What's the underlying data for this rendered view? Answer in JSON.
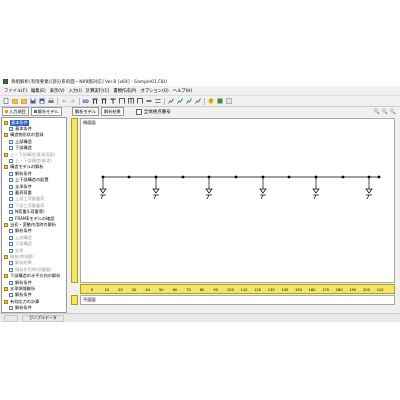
{
  "window": {
    "title": "骨組解析(有限要素)[部分系斜面・N09版対応] Ver.8 [x64] - Sample01.F8U"
  },
  "menu": [
    "ファイル(F)",
    "編集(E)",
    "表示(V)",
    "入力(I)",
    "計算実行(C)",
    "書類作成(P)",
    "オプション(O)",
    "ヘルプ(H)"
  ],
  "left_tabs": [
    "入力項目",
    "解析モデル"
  ],
  "tree": [
    {
      "label": "基本条件",
      "type": "folder",
      "level": 0,
      "state": "selected"
    },
    {
      "label": "基本条件",
      "type": "doc",
      "level": 1,
      "state": "normal"
    },
    {
      "label": "構造物形状の登録",
      "type": "folder",
      "level": 0,
      "state": "normal"
    },
    {
      "label": "上部構造",
      "type": "doc",
      "level": 1,
      "state": "normal"
    },
    {
      "label": "下部構造",
      "type": "doc",
      "level": 1,
      "state": "normal"
    },
    {
      "label": "上・下部構造(基本画面)",
      "type": "folder",
      "level": 0,
      "state": "dim"
    },
    {
      "label": "上・下部構造(基本)",
      "type": "doc",
      "level": 1,
      "state": "dim"
    },
    {
      "label": "構造モデルの解析",
      "type": "folder",
      "level": 0,
      "state": "normal"
    },
    {
      "label": "解析条件",
      "type": "doc",
      "level": 1,
      "state": "normal"
    },
    {
      "label": "上下部構造の配置",
      "type": "doc",
      "level": 1,
      "state": "normal"
    },
    {
      "label": "支承条件",
      "type": "doc",
      "level": 1,
      "state": "normal"
    },
    {
      "label": "載荷荷重",
      "type": "doc",
      "level": 1,
      "state": "normal"
    },
    {
      "label": "上部工荷重載荷",
      "type": "doc",
      "level": 1,
      "state": "dim"
    },
    {
      "label": "下部工荷重載荷",
      "type": "doc",
      "level": 1,
      "state": "dim"
    },
    {
      "label": "N荷重(L荷重等)",
      "type": "doc",
      "level": 1,
      "state": "normal"
    },
    {
      "label": "FRAMEモデルの確認",
      "type": "doc",
      "level": 1,
      "state": "normal"
    },
    {
      "label": "当初・変動作用時の解析",
      "type": "folder",
      "level": 0,
      "state": "normal"
    },
    {
      "label": "解析条件",
      "type": "doc",
      "level": 1,
      "state": "normal"
    },
    {
      "label": "上部構造",
      "type": "doc",
      "level": 1,
      "state": "dim"
    },
    {
      "label": "下部構造",
      "type": "doc",
      "level": 1,
      "state": "dim"
    },
    {
      "label": "支承",
      "type": "doc",
      "level": 1,
      "state": "dim"
    },
    {
      "label": "偶発(時刻歴)",
      "type": "folder",
      "level": 0,
      "state": "dim"
    },
    {
      "label": "解析結果",
      "type": "doc",
      "level": 1,
      "state": "dim"
    },
    {
      "label": "偶発作用時(地震動)",
      "type": "doc",
      "level": 1,
      "state": "dim"
    },
    {
      "label": "下部構造の水平方向の解析",
      "type": "folder",
      "level": 0,
      "state": "normal"
    },
    {
      "label": "解析条件",
      "type": "doc",
      "level": 1,
      "state": "normal"
    },
    {
      "label": "支承領域解析",
      "type": "folder",
      "level": 0,
      "state": "normal"
    },
    {
      "label": "解析条件",
      "type": "doc",
      "level": 1,
      "state": "normal"
    },
    {
      "label": "有効応力の計算",
      "type": "folder",
      "level": 0,
      "state": "normal"
    },
    {
      "label": "解析条件",
      "type": "doc",
      "level": 1,
      "state": "normal"
    }
  ],
  "right_tabs": [
    "解析モデル",
    "解析結果"
  ],
  "checkbox_label": "全体格点番号",
  "upper_pane_label": "側面図",
  "lower_pane_label": "平面図",
  "ruler_ticks": [
    "0",
    "10",
    "20",
    "30",
    "40",
    "50",
    "60",
    "70",
    "80",
    "90",
    "100",
    "110",
    "120",
    "130",
    "140",
    "150",
    "160",
    "170",
    "180",
    "190",
    "200",
    "210"
  ],
  "status": [
    "ガンプルデータ"
  ]
}
